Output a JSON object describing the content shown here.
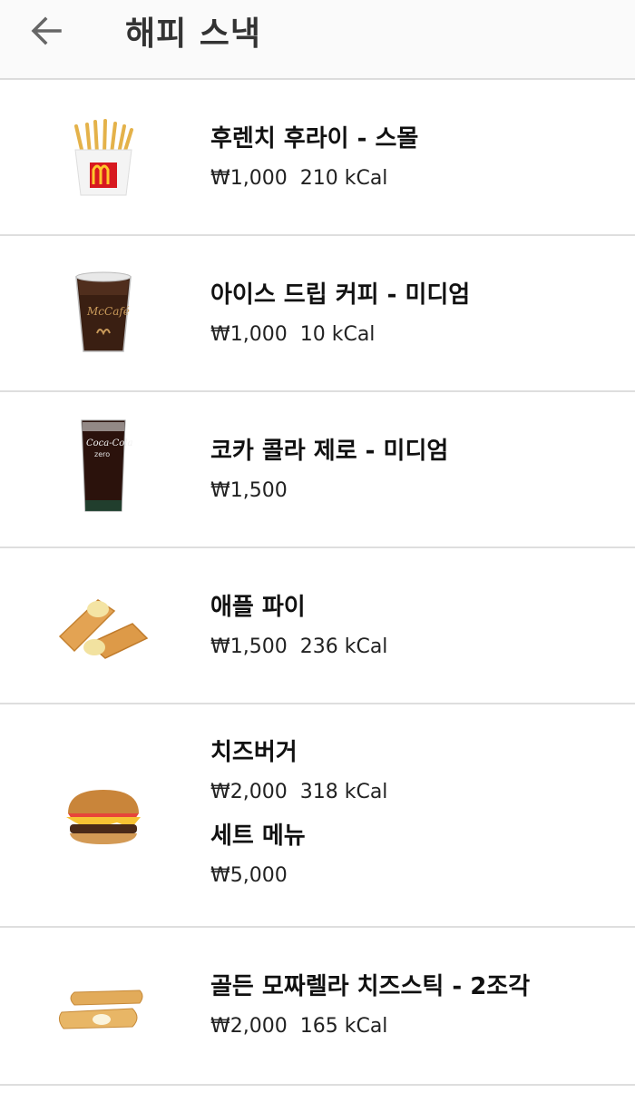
{
  "header": {
    "back_icon": "arrow-left-icon",
    "title": "해피 스낵"
  },
  "items": [
    {
      "name": "후렌치 후라이 - 스몰",
      "price": "₩1,000",
      "kcal": "210 kCal",
      "icon": "fries-image"
    },
    {
      "name": "아이스 드립 커피 - 미디엄",
      "price": "₩1,000",
      "kcal": "10 kCal",
      "icon": "iced-coffee-image"
    },
    {
      "name": "코카 콜라 제로 - 미디엄",
      "price": "₩1,500",
      "kcal": "",
      "icon": "coke-zero-image"
    },
    {
      "name": "애플 파이",
      "price": "₩1,500",
      "kcal": "236 kCal",
      "icon": "apple-pie-image"
    },
    {
      "name": "치즈버거",
      "price": "₩2,000",
      "kcal": "318 kCal",
      "icon": "cheeseburger-image",
      "set_name": "세트 메뉴",
      "set_price": "₩5,000"
    },
    {
      "name": "골든 모짜렐라 치즈스틱 - 2조각",
      "price": "₩2,000",
      "kcal": "165 kCal",
      "icon": "cheese-stick-image"
    }
  ]
}
